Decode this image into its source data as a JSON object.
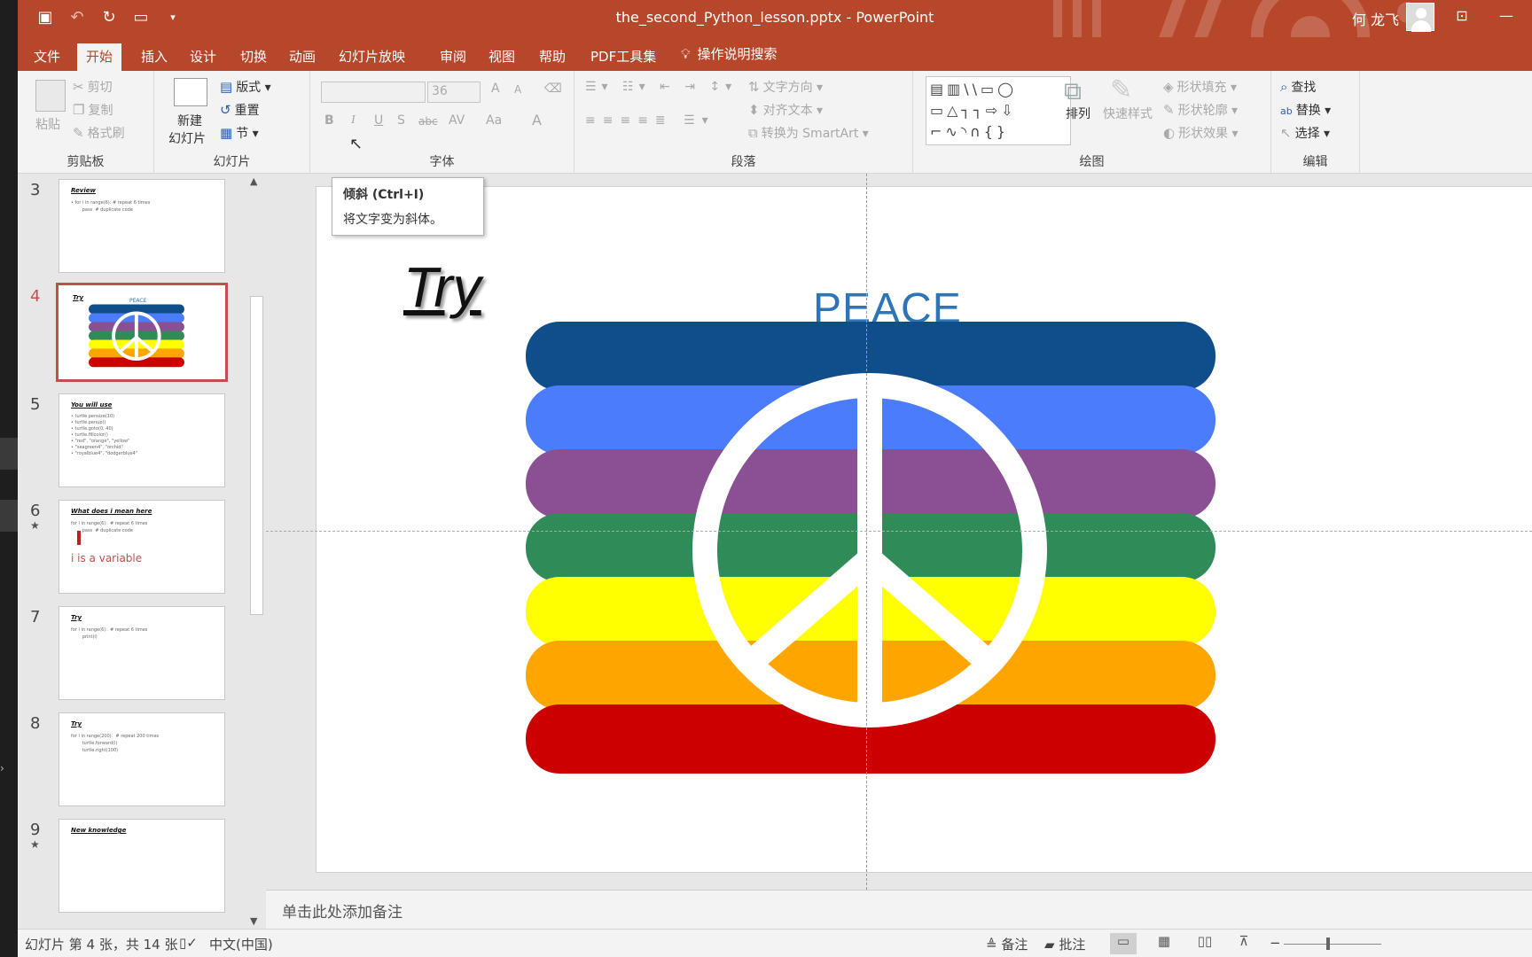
{
  "window": {
    "title": "the_second_Python_lesson.pptx  -  PowerPoint",
    "user": "何 龙飞",
    "restore_icon": "ribbon-display-icon",
    "minimize": "—"
  },
  "qat": [
    "save-icon",
    "undo-icon",
    "redo-icon",
    "present-icon",
    "customize-icon"
  ],
  "tabs": [
    "文件",
    "开始",
    "插入",
    "设计",
    "切换",
    "动画",
    "幻灯片放映",
    "审阅",
    "视图",
    "帮助",
    "PDF工具集"
  ],
  "tell_me": "操作说明搜索",
  "ribbon": {
    "clipboard": {
      "paste": "粘贴",
      "cut": "剪切",
      "copy": "复制",
      "format_painter": "格式刷",
      "label": "剪贴板"
    },
    "slides": {
      "new_slide_1": "新建",
      "new_slide_2": "幻灯片",
      "layout": "版式",
      "reset": "重置",
      "section": "节",
      "label": "幻灯片"
    },
    "font": {
      "font_name": "",
      "font_size": "36",
      "bold": "B",
      "italic": "I",
      "underline": "U",
      "shadow": "S",
      "strike": "abc",
      "spacing": "AV",
      "case": "Aa",
      "color": "A",
      "grow": "A",
      "shrink": "A",
      "label": "字体"
    },
    "paragraph": {
      "text_direction": "文字方向",
      "align_text": "对齐文本",
      "smartart": "转换为 SmartArt",
      "label": "段落"
    },
    "drawing": {
      "arrange": "排列",
      "quick_styles": "快速样式",
      "fill": "形状填充",
      "outline": "形状轮廓",
      "effects": "形状效果",
      "label": "绘图"
    },
    "editing": {
      "find": "查找",
      "replace": "替换",
      "select": "选择",
      "label": "编辑"
    }
  },
  "tooltip": {
    "title": "倾斜 (Ctrl+I)",
    "desc": "将文字变为斜体。"
  },
  "thumbnails": [
    {
      "num": "3",
      "title": "Review",
      "body": "• for i in range(6): # repeat 6 times\n        pass  # duplicate code",
      "star": ""
    },
    {
      "num": "4",
      "title": "Try",
      "body": "",
      "star": "",
      "peace": "PEACE"
    },
    {
      "num": "5",
      "title": "You will use",
      "body": "• turtle.pensize(10)\n• turtle.penup()\n• turtle.goto(0, 40)\n• turtle.fillcolor()\n• \"red\", \"orange\", \"yellow\"\n• \"seagreen4\", \"orchid\"\n• \"royalblue4\", \"dodgerblue4\"",
      "star": ""
    },
    {
      "num": "6",
      "title": "What does i mean here",
      "body": "for i in range(6):  # repeat 6 times\n        pass  # duplicate code",
      "red": "i is a variable",
      "star": "★"
    },
    {
      "num": "7",
      "title": "Try",
      "body": "for i in range(6):  # repeat 6 times\n        print(i)",
      "star": ""
    },
    {
      "num": "8",
      "title": "Try",
      "body": "for i in range(200):  # repeat 200 times\n        turtle.forward(i)\n        turtle.right(100)",
      "star": ""
    },
    {
      "num": "9",
      "title": "New knowledge",
      "body": "",
      "star": "★"
    }
  ],
  "slide": {
    "title": "Try",
    "heading": "PEACE"
  },
  "flag_colors": [
    "#0f4e8a",
    "#4a7cfc",
    "#8b4f94",
    "#2f8c59",
    "#ffff00",
    "#ffa500",
    "#cc0000"
  ],
  "notes_placeholder": "单击此处添加备注",
  "status": {
    "slide_info": "幻灯片 第 4 张，共 14 张",
    "language": "中文(中国)",
    "notes": "备注",
    "comments": "批注"
  }
}
